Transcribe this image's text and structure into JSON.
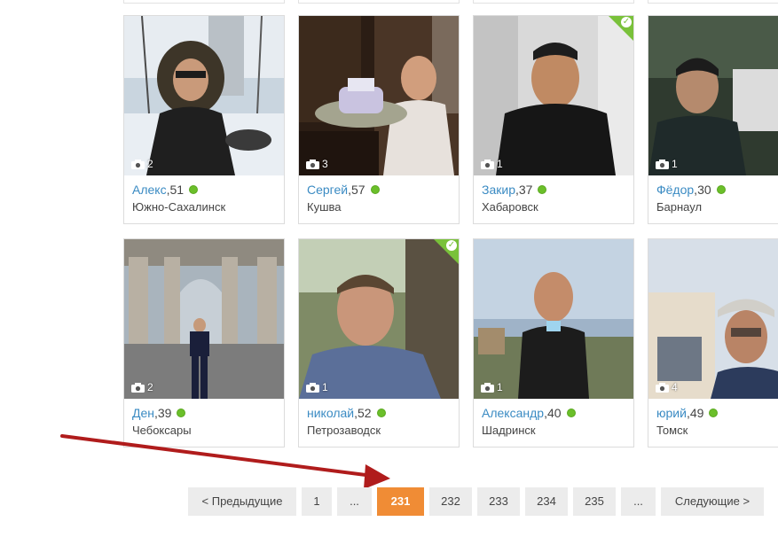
{
  "cards_row1": [
    {
      "name": "Алекс",
      "age": "51",
      "city": "Южно-Сахалинск",
      "photos": "2",
      "verified": false
    },
    {
      "name": "Сергей",
      "age": "57",
      "city": "Кушва",
      "photos": "3",
      "verified": false
    },
    {
      "name": "Закир",
      "age": "37",
      "city": "Хабаровск",
      "photos": "1",
      "verified": true
    },
    {
      "name": "Фёдор",
      "age": "30",
      "city": "Барнаул",
      "photos": "1",
      "verified": false
    }
  ],
  "cards_row2": [
    {
      "name": "Ден",
      "age": "39",
      "city": "Чебоксары",
      "photos": "2",
      "verified": false
    },
    {
      "name": "николай",
      "age": "52",
      "city": "Петрозаводск",
      "photos": "1",
      "verified": true
    },
    {
      "name": "Александр",
      "age": "40",
      "city": "Шадринск",
      "photos": "1",
      "verified": false
    },
    {
      "name": "юрий",
      "age": "49",
      "city": "Томск",
      "photos": "4",
      "verified": false
    }
  ],
  "pagination": {
    "prev": "< Предыдущие",
    "first": "1",
    "ellipsis": "...",
    "current": "231",
    "p232": "232",
    "p233": "233",
    "p234": "234",
    "p235": "235",
    "next": "Следующие >"
  },
  "colors": {
    "link": "#3b8bc3",
    "active_page": "#f08c35",
    "online": "#6bbf2a",
    "verified": "#79c13a",
    "arrow": "#b01c1c"
  },
  "icons": {
    "camera": "camera-icon",
    "online": "online-dot-icon",
    "verified": "verified-check-icon"
  }
}
